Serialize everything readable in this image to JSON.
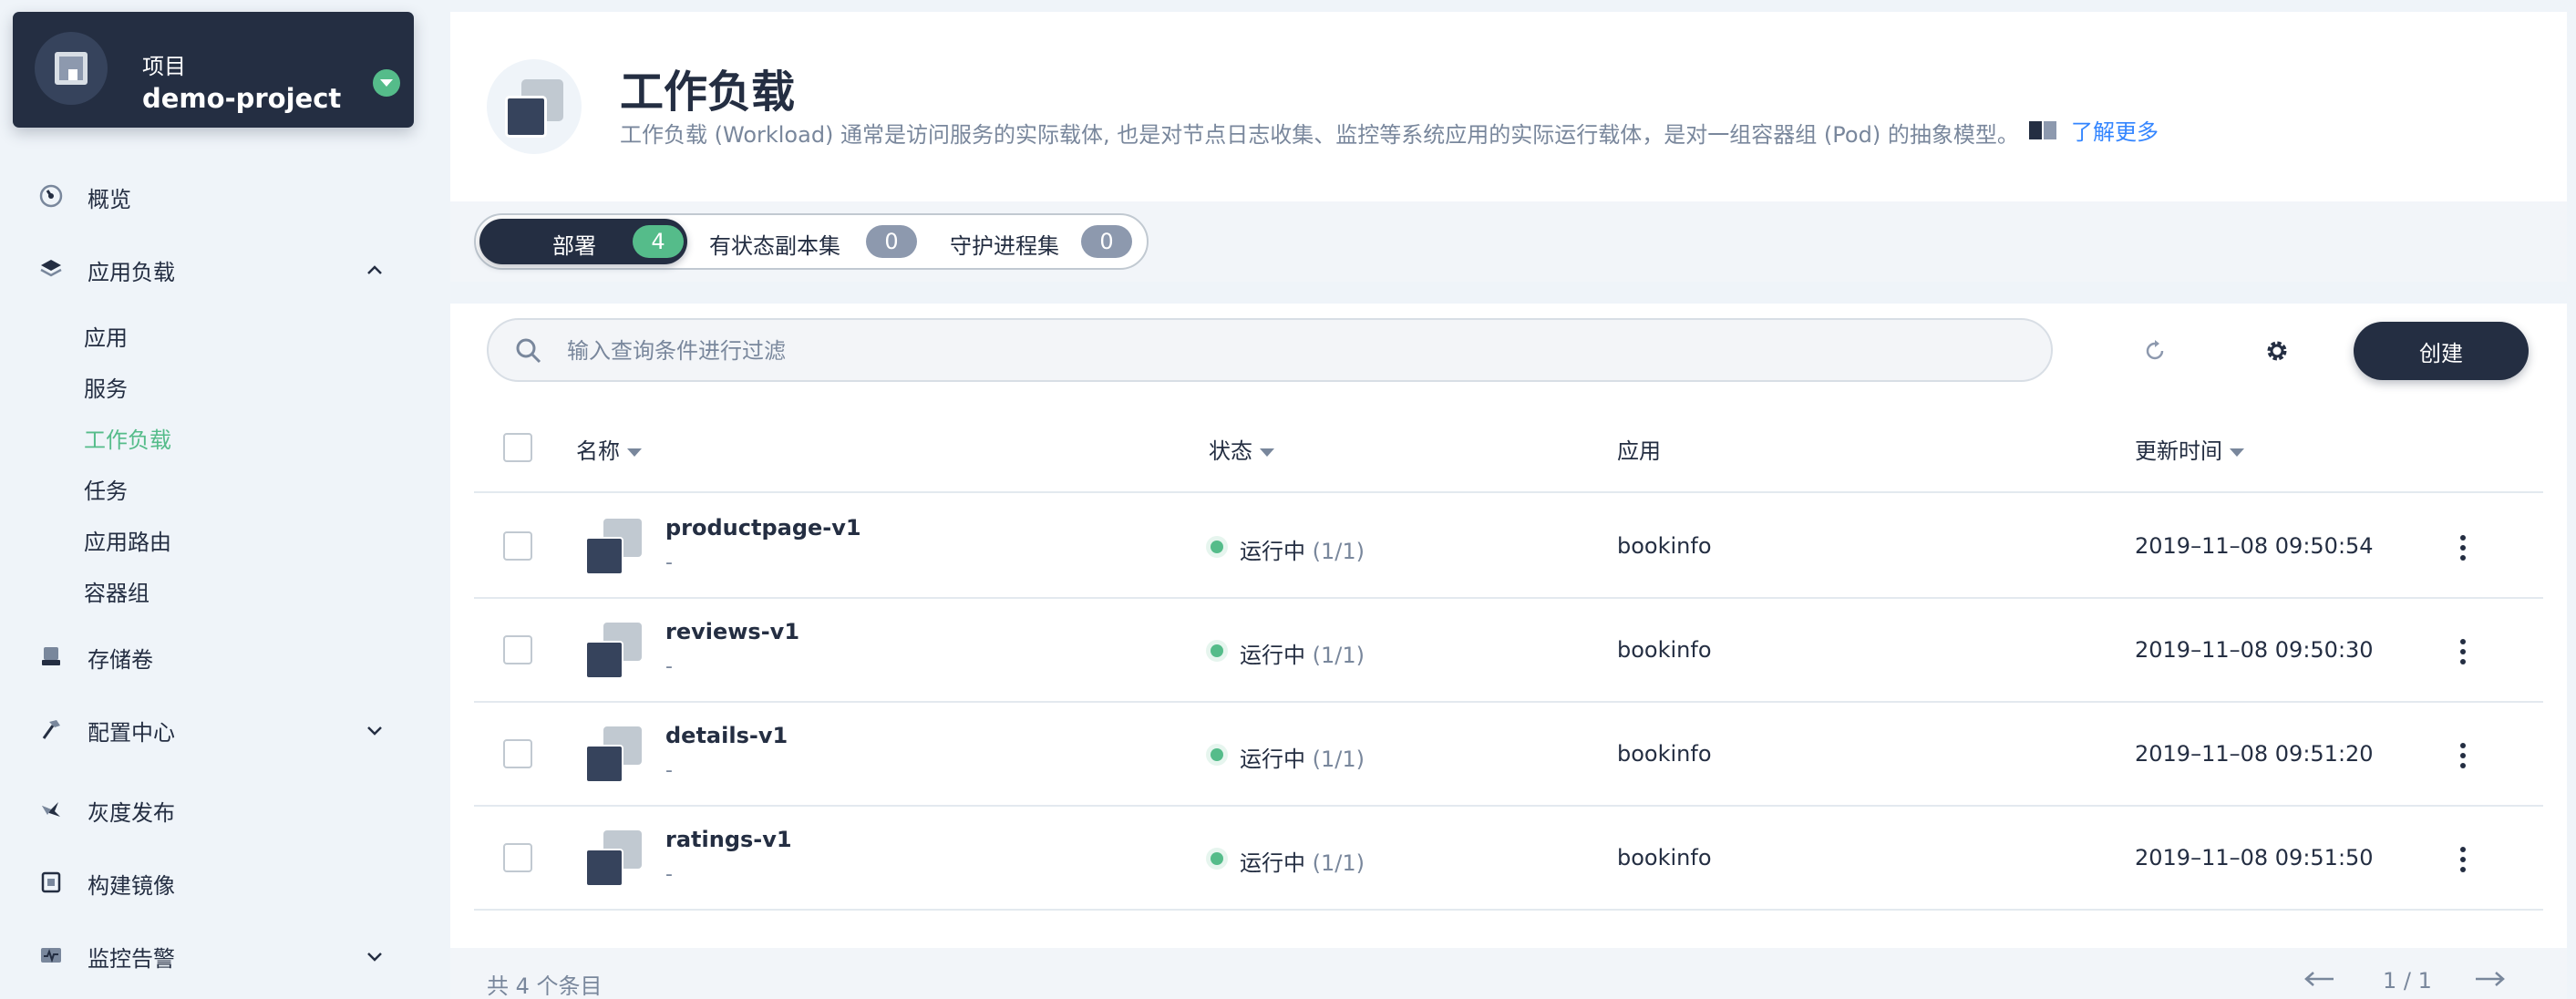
{
  "project": {
    "caption": "项目",
    "name": "demo-project"
  },
  "sidebar": {
    "items": [
      {
        "label": "概览",
        "icon": "dashboard-icon"
      },
      {
        "label": "应用负载",
        "icon": "layers-icon",
        "expanded": true,
        "children": [
          "应用",
          "服务",
          "工作负载",
          "任务",
          "应用路由",
          "容器组"
        ],
        "active_child": "工作负载"
      },
      {
        "label": "存储卷",
        "icon": "storage-icon"
      },
      {
        "label": "配置中心",
        "icon": "hammer-icon",
        "expanded": false
      },
      {
        "label": "灰度发布",
        "icon": "bird-icon"
      },
      {
        "label": "构建镜像",
        "icon": "image-build-icon"
      },
      {
        "label": "监控告警",
        "icon": "monitor-icon",
        "expanded": false
      }
    ]
  },
  "header": {
    "title": "工作负载",
    "description": "工作负载 (Workload) 通常是访问服务的实际载体, 也是对节点日志收集、监控等系统应用的实际运行载体，是对一组容器组 (Pod) 的抽象模型。",
    "learn_more": "了解更多"
  },
  "tabs": [
    {
      "label": "部署",
      "count": "4",
      "active": true
    },
    {
      "label": "有状态副本集",
      "count": "0",
      "active": false
    },
    {
      "label": "守护进程集",
      "count": "0",
      "active": false
    }
  ],
  "toolbar": {
    "search_placeholder": "输入查询条件进行过滤",
    "create_label": "创建"
  },
  "table": {
    "columns": [
      "名称",
      "状态",
      "应用",
      "更新时间"
    ],
    "rows": [
      {
        "name": "productpage-v1",
        "desc": "-",
        "status": "运行中",
        "ratio": "(1/1)",
        "app": "bookinfo",
        "updated": "2019–11–08 09:50:54"
      },
      {
        "name": "reviews-v1",
        "desc": "-",
        "status": "运行中",
        "ratio": "(1/1)",
        "app": "bookinfo",
        "updated": "2019–11–08 09:50:30"
      },
      {
        "name": "details-v1",
        "desc": "-",
        "status": "运行中",
        "ratio": "(1/1)",
        "app": "bookinfo",
        "updated": "2019–11–08 09:51:20"
      },
      {
        "name": "ratings-v1",
        "desc": "-",
        "status": "运行中",
        "ratio": "(1/1)",
        "app": "bookinfo",
        "updated": "2019–11–08 09:51:50"
      }
    ]
  },
  "footer": {
    "total": "共 4 个条目",
    "page": "1 / 1"
  },
  "colors": {
    "accent": "#55bc8a",
    "dark": "#242e42",
    "muted": "#79879c",
    "link": "#3385ff"
  }
}
